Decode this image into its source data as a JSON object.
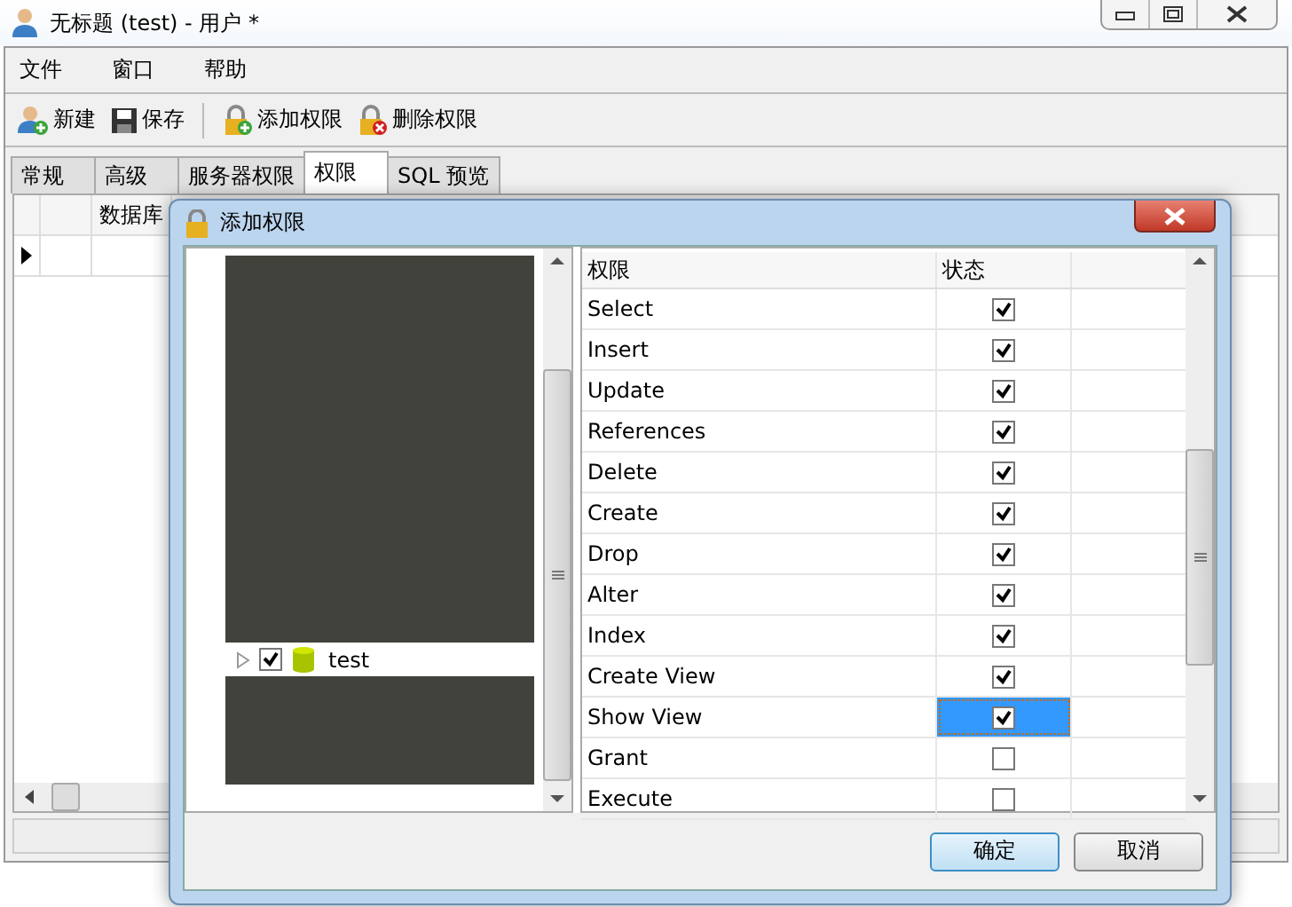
{
  "window": {
    "title": "无标题 (test) - 用户 *"
  },
  "menu": [
    "文件",
    "窗口",
    "帮助"
  ],
  "toolbar": [
    {
      "label": "新建",
      "kind": "new"
    },
    {
      "label": "保存",
      "kind": "save"
    },
    {
      "label": "添加权限",
      "kind": "add"
    },
    {
      "label": "删除权限",
      "kind": "delete"
    }
  ],
  "tabs": [
    {
      "label": "常规",
      "selected": false
    },
    {
      "label": "高级",
      "selected": false
    },
    {
      "label": "服务器权限",
      "selected": false
    },
    {
      "label": "权限",
      "selected": true
    },
    {
      "label": "SQL 预览",
      "selected": false
    }
  ],
  "grid": {
    "columns": [
      "数据库"
    ]
  },
  "dialog": {
    "title": "添加权限",
    "tree": [
      {
        "label": "test",
        "checked": true,
        "expanded": false
      }
    ],
    "columns": [
      "权限",
      "状态"
    ],
    "rows": [
      {
        "name": "Select",
        "checked": true,
        "selected": false
      },
      {
        "name": "Insert",
        "checked": true,
        "selected": false
      },
      {
        "name": "Update",
        "checked": true,
        "selected": false
      },
      {
        "name": "References",
        "checked": true,
        "selected": false
      },
      {
        "name": "Delete",
        "checked": true,
        "selected": false
      },
      {
        "name": "Create",
        "checked": true,
        "selected": false
      },
      {
        "name": "Drop",
        "checked": true,
        "selected": false
      },
      {
        "name": "Alter",
        "checked": true,
        "selected": false
      },
      {
        "name": "Index",
        "checked": true,
        "selected": false
      },
      {
        "name": "Create View",
        "checked": true,
        "selected": false
      },
      {
        "name": "Show View",
        "checked": true,
        "selected": true
      },
      {
        "name": "Grant",
        "checked": false,
        "selected": false
      },
      {
        "name": "Execute",
        "checked": false,
        "selected": false
      }
    ],
    "buttons": [
      {
        "label": "确定",
        "kind": "default"
      },
      {
        "label": "取消",
        "kind": "normal"
      }
    ]
  }
}
